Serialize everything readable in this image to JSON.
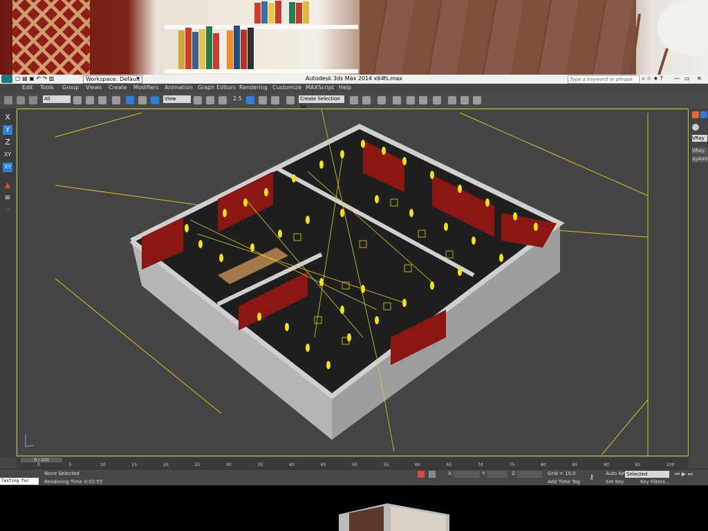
{
  "window": {
    "title": "Autodesk 3ds Max  2014 x64",
    "file": "fs.max",
    "search_placeholder": "Type a keyword or phrase"
  },
  "workspace": {
    "label": "Workspace: Default"
  },
  "menu": [
    "Edit",
    "Tools",
    "Group",
    "Views",
    "Create",
    "Modifiers",
    "Animation",
    "Graph Editors",
    "Rendering",
    "Customize",
    "MAXScript",
    "Help"
  ],
  "toolbar": {
    "filter": "All",
    "ref_coord": "View",
    "snap_value": "2.5",
    "selection_set": "Create Selection Se"
  },
  "axes": [
    "X",
    "Y",
    "Z",
    "XY",
    "XY"
  ],
  "right_panel": {
    "renderer": "VRay",
    "item1": "VRay",
    "item2": "ayAmb"
  },
  "timeline": {
    "frame_label": "0 / 100",
    "ticks": [
      "0",
      "5",
      "10",
      "15",
      "20",
      "25",
      "30",
      "35",
      "40",
      "45",
      "50",
      "55",
      "60",
      "65",
      "70",
      "75",
      "80",
      "85",
      "90",
      "95",
      "100"
    ]
  },
  "status": {
    "script_label": "Testing for ALL",
    "selection": "None Selected",
    "render_time": "Rendering Time 0:02:55",
    "x_label": "X:",
    "y_label": "Y:",
    "z_label": "Z:",
    "grid": "Grid = 10.0",
    "add_time_tag": "Add Time Tag",
    "auto_key": "Auto Key",
    "set_key": "Set Key",
    "selected": "Selected",
    "key_filters": "Key Filters..."
  },
  "colors": {
    "viewport_border": "#cfcf3a",
    "active_blue": "#2d7fd6",
    "wall_red": "#8a1712",
    "light": "#f3e21a",
    "line": "#d8c21a"
  }
}
